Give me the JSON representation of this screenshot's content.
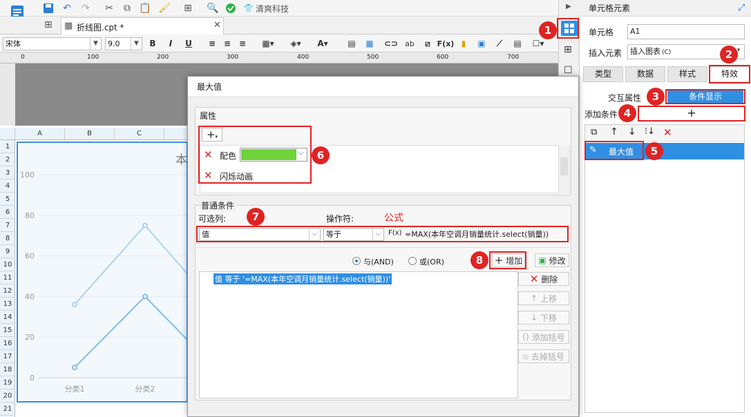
{
  "doc_tab": {
    "name": "折线图.cpt *"
  },
  "toolbar": {
    "app_label": "清爽科技"
  },
  "format": {
    "font": "宋体",
    "size": "9.0",
    "bold": "B",
    "italic": "I",
    "underline": "U",
    "formula": "F(x)",
    "ab": "ab"
  },
  "ruler": {
    "ticks": [
      "0",
      "100",
      "200",
      "300",
      "400",
      "500",
      "600",
      "700"
    ]
  },
  "sheet": {
    "columns": [
      "A",
      "B",
      "C"
    ],
    "rows": [
      "1",
      "2",
      "3",
      "4",
      "5",
      "6",
      "7",
      "8",
      "9",
      "10",
      "11",
      "12",
      "13",
      "14",
      "15",
      "16",
      "17",
      "18",
      "19",
      "20",
      "21"
    ]
  },
  "chart_data": {
    "type": "line",
    "title": "本",
    "categories": [
      "分类1",
      "分类2"
    ],
    "y_ticks": [
      "0",
      "20",
      "40",
      "60",
      "80",
      "100"
    ],
    "ylim": [
      0,
      100
    ],
    "series": [
      {
        "values": [
          36,
          75
        ],
        "color": "#a9d3f2"
      },
      {
        "values": [
          5,
          40
        ],
        "color": "#7fbde8"
      }
    ]
  },
  "right_panel": {
    "title": "单元格元素",
    "cell_label": "单元格",
    "cell_value": "A1",
    "insert_label": "插入元素",
    "insert_value": "插入图表",
    "insert_shortcut": "(C)",
    "tabs": [
      "类型",
      "数据",
      "样式",
      "特效"
    ],
    "interact_label": "交互属性",
    "condition_display": "条件显示",
    "add_condition_label": "添加条件",
    "add_symbol": "+",
    "condition_item": "最大值"
  },
  "dialog": {
    "title": "最大值",
    "property_group": "属性",
    "add_symbol": "+",
    "color_label": "配色",
    "color_value": "#6fd33a",
    "flash_label": "闪烁动画",
    "normal_condition_group": "普通条件",
    "optional_column_label": "可选列:",
    "operator_label": "操作符:",
    "formula_hint": "公式",
    "column_value": "值",
    "operator_value": "等于",
    "formula_icon": "F(x)",
    "formula_value": "=MAX(本年空调月销量统计.select(销量))",
    "and_label": "与(AND)",
    "or_label": "或(OR)",
    "add_button": "增加",
    "modify_button": "修改",
    "condition_list": [
      "值 等于 '=MAX(本年空调月销量统计.select(销量))'"
    ],
    "delete_button": "删除",
    "up_button": "上移",
    "down_button": "下移",
    "add_bracket_button": "添加括号",
    "remove_bracket_button": "去掉括号"
  },
  "annotations": [
    "1",
    "2",
    "3",
    "4",
    "5",
    "6",
    "7",
    "8"
  ],
  "colors": {
    "accent": "#3d8ee0",
    "annotation": "#e02323",
    "selected": "#2f8fe3"
  }
}
